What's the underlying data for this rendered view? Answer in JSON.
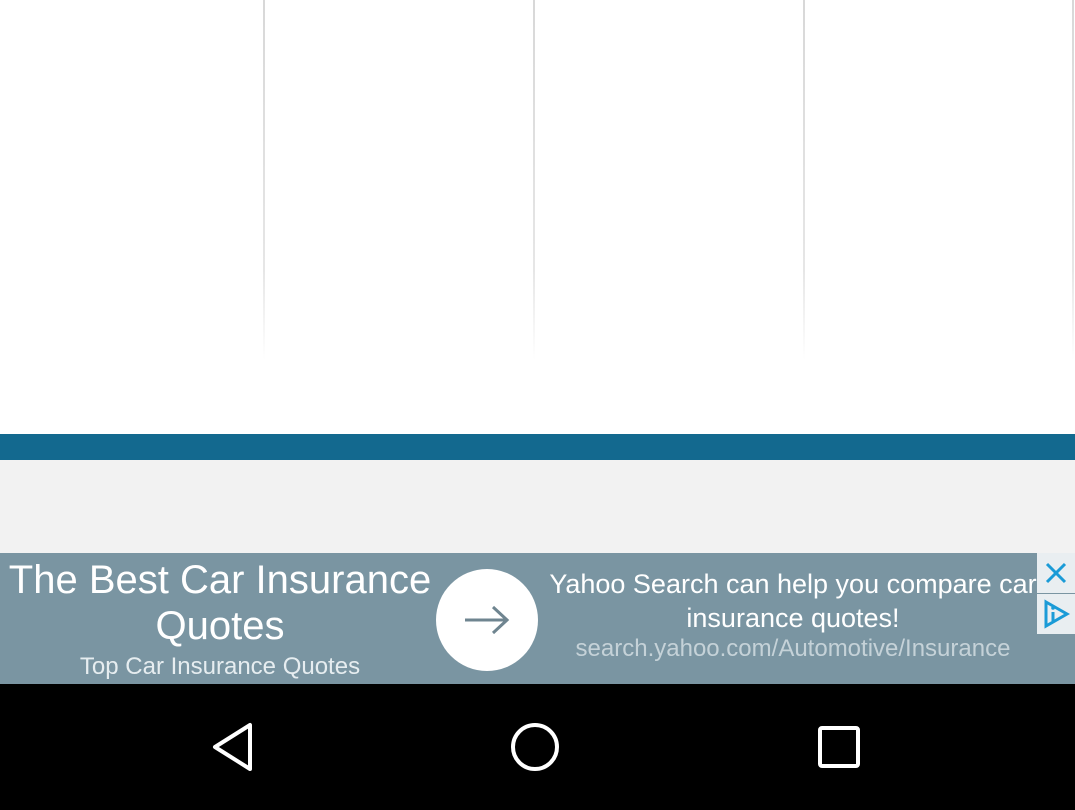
{
  "colors": {
    "accent_bar": "#13698f",
    "ad_background": "#7a95a2",
    "ad_icon_blue": "#1a9bd7",
    "nav_background": "#000000"
  },
  "ad": {
    "title": "The Best Car Insurance Quotes",
    "subtitle": "Top Car Insurance Quotes",
    "description": "Yahoo Search can help you compare car insurance quotes!",
    "url": "search.yahoo.com/Automotive/Insurance",
    "arrow_icon": "arrow-right-icon",
    "close_icon": "close-icon",
    "adchoices_icon": "adchoices-icon"
  },
  "nav": {
    "back_icon": "back-triangle-icon",
    "home_icon": "home-circle-icon",
    "recents_icon": "recents-square-icon"
  }
}
